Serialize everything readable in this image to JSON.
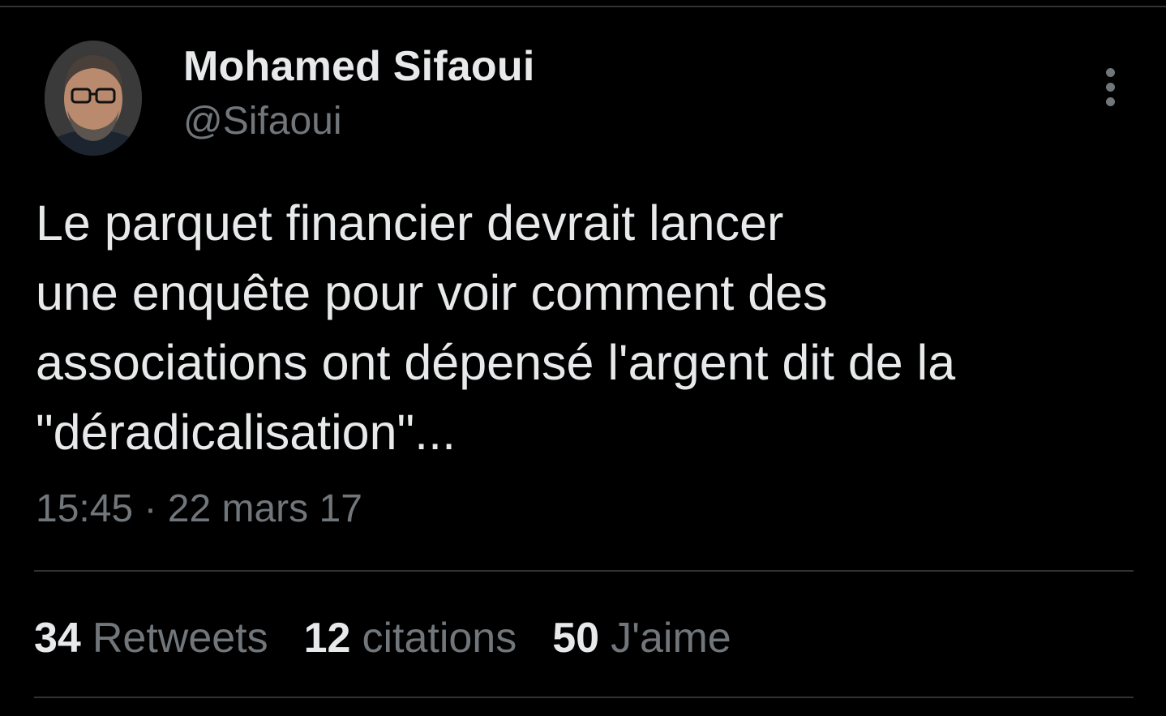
{
  "tweet": {
    "author": {
      "display_name": "Mohamed Sifaoui",
      "handle": "@Sifaoui",
      "avatar_icon": "profile-photo"
    },
    "menu_icon": "more-vertical-icon",
    "text": "Le parquet financier devrait lancer\nune enquête pour voir comment des\nassociations ont dépensé l'argent dit de la\n\"déradicalisation\"...",
    "timestamp": "15:45 · 22 mars 17",
    "stats": {
      "retweets": {
        "count": "34",
        "label": "Retweets"
      },
      "quotes": {
        "count": "12",
        "label": "citations"
      },
      "likes": {
        "count": "50",
        "label": "J'aime"
      }
    }
  },
  "colors": {
    "background": "#000000",
    "primary_text": "#e7e9ea",
    "secondary_text": "#71767b",
    "divider": "#2f3336"
  }
}
